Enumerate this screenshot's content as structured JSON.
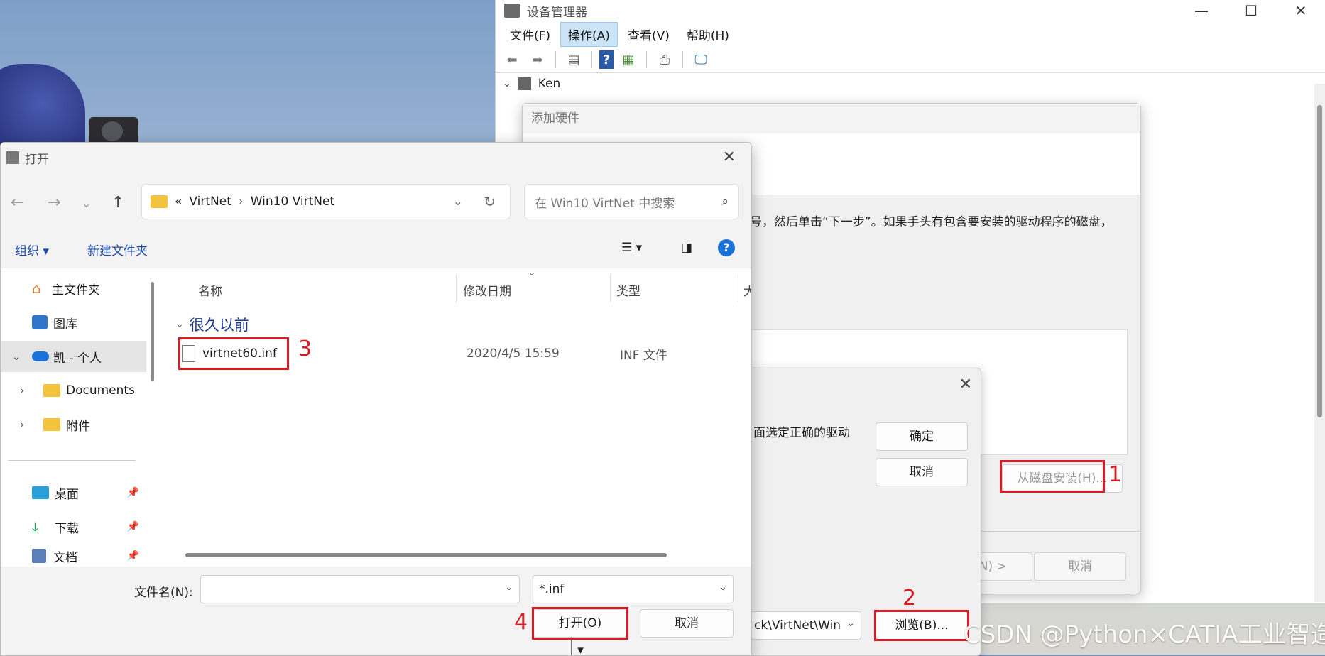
{
  "device_manager": {
    "title": "设备管理器",
    "menus": [
      "文件(F)",
      "操作(A)",
      "查看(V)",
      "帮助(H)"
    ],
    "tree_root": "Ken"
  },
  "add_hardware": {
    "title": "添加硬件",
    "description": "号，然后单击“下一步”。如果手头有包含要安装的驱动程序的磁盘，",
    "disk_install_button": "从磁盘安装(H)...",
    "next_button": "(N) >",
    "cancel_button": "取消"
  },
  "install_disk": {
    "message": "面选定正确的驱动",
    "ok_button": "确定",
    "cancel_button": "取消",
    "path_value": "ck\\VirtNet\\Win",
    "browse_button": "浏览(B)..."
  },
  "open_dialog": {
    "title": "打开",
    "breadcrumb": [
      "«",
      "VirtNet",
      "Win10 VirtNet"
    ],
    "search_placeholder": "在 Win10 VirtNet 中搜索",
    "organize": "组织",
    "new_folder": "新建文件夹",
    "nav_items": [
      {
        "label": "主文件夹",
        "icon": "home-icon"
      },
      {
        "label": "图库",
        "icon": "gallery-icon"
      },
      {
        "label": "凯 - 个人",
        "icon": "cloud-icon"
      },
      {
        "label": "Documents",
        "icon": "folder-icon"
      },
      {
        "label": "附件",
        "icon": "folder-icon"
      },
      {
        "label": "桌面",
        "icon": "desktop-icon"
      },
      {
        "label": "下载",
        "icon": "download-icon"
      },
      {
        "label": "文档",
        "icon": "document-icon"
      }
    ],
    "columns": [
      "名称",
      "修改日期",
      "类型",
      "大"
    ],
    "group_label": "很久以前",
    "files": [
      {
        "name": "virtnet60.inf",
        "modified": "2020/4/5 15:59",
        "type": "INF 文件"
      }
    ],
    "filename_label": "文件名(N):",
    "filename_value": "",
    "filter_value": "*.inf",
    "open_button": "打开(O)",
    "cancel_button": "取消"
  },
  "annotations": [
    "1",
    "2",
    "3",
    "4"
  ],
  "watermark": "CSDN @Python×CATIA工业智造",
  "colors": {
    "annotation_red": "#d81c25",
    "link_blue": "#1b4aa8",
    "menu_highlight": "#cce4f7"
  }
}
